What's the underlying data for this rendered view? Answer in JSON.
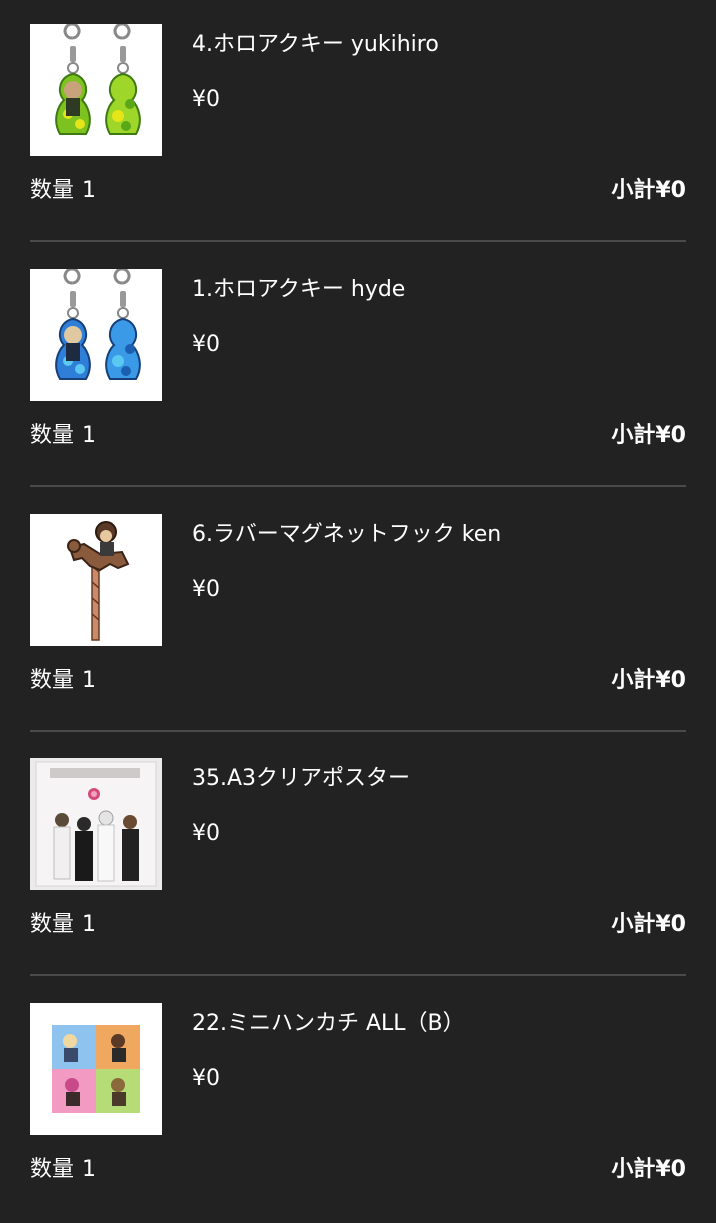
{
  "cart": {
    "items": [
      {
        "name": "4.ホロアクキー yukihiro",
        "price": "¥0",
        "qty_label": "数量",
        "qty_value": "1",
        "subtotal": "小計¥0",
        "image_icon": "green-acrylic-keychain-pair",
        "image_accent": "#7dc21e"
      },
      {
        "name": "1.ホロアクキー hyde",
        "price": "¥0",
        "qty_label": "数量",
        "qty_value": "1",
        "subtotal": "小計¥0",
        "image_icon": "blue-acrylic-keychain-pair",
        "image_accent": "#2f7fd8"
      },
      {
        "name": "6.ラバーマグネットフック ken",
        "price": "¥0",
        "qty_label": "数量",
        "qty_value": "1",
        "subtotal": "小計¥0",
        "image_icon": "carousel-horse-magnet-hook",
        "image_accent": "#8a5a3c"
      },
      {
        "name": "35.A3クリアポスター",
        "price": "¥0",
        "qty_label": "数量",
        "qty_value": "1",
        "subtotal": "小計¥0",
        "image_icon": "band-poster",
        "image_accent": "#d44a7a"
      },
      {
        "name": "22.ミニハンカチ ALL（B）",
        "price": "¥0",
        "qty_label": "数量",
        "qty_value": "1",
        "subtotal": "小計¥0",
        "image_icon": "four-panel-handkerchief",
        "image_accent": "#8fc3ef"
      }
    ]
  },
  "colors": {
    "background": "#222222",
    "text": "#ffffff",
    "divider": "#4a4a4a"
  }
}
